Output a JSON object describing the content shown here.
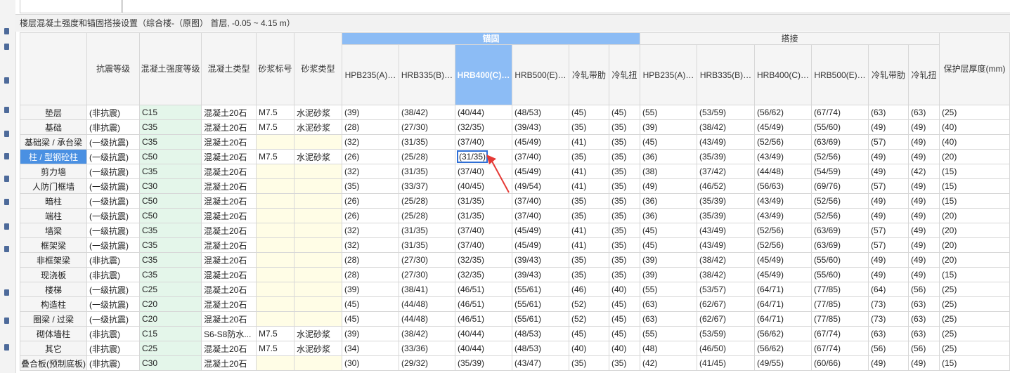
{
  "title": "楼层混凝土强度和锚固搭接设置（综合楼-（原图） 首层, -0.05 ~ 4.15 m）",
  "header": {
    "group_anchor": "锚固",
    "group_lap": "搭接",
    "columns": [
      "抗震等级",
      "混凝土强度等级",
      "混凝土类型",
      "砂浆标号",
      "砂浆类型",
      "HPB235(A)…",
      "HRB335(B)…",
      "HRB400(C)…",
      "HRB500(E)…",
      "冷轧带肋",
      "冷轧扭",
      "HPB235(A)…",
      "HRB335(B)…",
      "HRB400(C)…",
      "HRB500(E)…",
      "冷轧带肋",
      "冷轧扭",
      "保护层厚度(mm)"
    ]
  },
  "rows": [
    {
      "name": "垫层",
      "cells": [
        "(非抗震)",
        "C15",
        "混凝土20石",
        "M7.5",
        "水泥砂浆",
        "(39)",
        "(38/42)",
        "(40/44)",
        "(48/53)",
        "(45)",
        "(45)",
        "(55)",
        "(53/59)",
        "(56/62)",
        "(67/74)",
        "(63)",
        "(63)",
        "(25)"
      ]
    },
    {
      "name": "基础",
      "cells": [
        "(非抗震)",
        "C35",
        "混凝土20石",
        "M7.5",
        "水泥砂浆",
        "(28)",
        "(27/30)",
        "(32/35)",
        "(39/43)",
        "(35)",
        "(35)",
        "(39)",
        "(38/42)",
        "(45/49)",
        "(55/60)",
        "(49)",
        "(49)",
        "(40)"
      ]
    },
    {
      "name": "基础梁 / 承台梁",
      "cells": [
        "(一级抗震)",
        "C35",
        "混凝土20石",
        "",
        "",
        "(32)",
        "(31/35)",
        "(37/40)",
        "(45/49)",
        "(41)",
        "(35)",
        "(45)",
        "(43/49)",
        "(52/56)",
        "(63/69)",
        "(57)",
        "(49)",
        "(40)"
      ]
    },
    {
      "name": "柱 / 型钢砼柱",
      "cells": [
        "(一级抗震)",
        "C50",
        "混凝土20石",
        "M7.5",
        "水泥砂浆",
        "(26)",
        "(25/28)",
        "(31/35)",
        "(37/40)",
        "(35)",
        "(35)",
        "(36)",
        "(35/39)",
        "(43/49)",
        "(52/56)",
        "(49)",
        "(49)",
        "(20)"
      ]
    },
    {
      "name": "剪力墙",
      "cells": [
        "(一级抗震)",
        "C35",
        "混凝土20石",
        "",
        "",
        "(32)",
        "(31/35)",
        "(37/40)",
        "(45/49)",
        "(41)",
        "(35)",
        "(38)",
        "(37/42)",
        "(44/48)",
        "(54/59)",
        "(49)",
        "(42)",
        "(15)"
      ]
    },
    {
      "name": "人防门框墙",
      "cells": [
        "(一级抗震)",
        "C30",
        "混凝土20石",
        "",
        "",
        "(35)",
        "(33/37)",
        "(40/45)",
        "(49/54)",
        "(41)",
        "(35)",
        "(49)",
        "(46/52)",
        "(56/63)",
        "(69/76)",
        "(57)",
        "(49)",
        "(15)"
      ]
    },
    {
      "name": "暗柱",
      "cells": [
        "(一级抗震)",
        "C50",
        "混凝土20石",
        "",
        "",
        "(26)",
        "(25/28)",
        "(31/35)",
        "(37/40)",
        "(35)",
        "(35)",
        "(36)",
        "(35/39)",
        "(43/49)",
        "(52/56)",
        "(49)",
        "(49)",
        "(15)"
      ]
    },
    {
      "name": "端柱",
      "cells": [
        "(一级抗震)",
        "C50",
        "混凝土20石",
        "",
        "",
        "(26)",
        "(25/28)",
        "(31/35)",
        "(37/40)",
        "(35)",
        "(35)",
        "(36)",
        "(35/39)",
        "(43/49)",
        "(52/56)",
        "(49)",
        "(49)",
        "(20)"
      ]
    },
    {
      "name": "墙梁",
      "cells": [
        "(一级抗震)",
        "C35",
        "混凝土20石",
        "",
        "",
        "(32)",
        "(31/35)",
        "(37/40)",
        "(45/49)",
        "(41)",
        "(35)",
        "(45)",
        "(43/49)",
        "(52/56)",
        "(63/69)",
        "(57)",
        "(49)",
        "(20)"
      ]
    },
    {
      "name": "框架梁",
      "cells": [
        "(一级抗震)",
        "C35",
        "混凝土20石",
        "",
        "",
        "(32)",
        "(31/35)",
        "(37/40)",
        "(45/49)",
        "(41)",
        "(35)",
        "(45)",
        "(43/49)",
        "(52/56)",
        "(63/69)",
        "(57)",
        "(49)",
        "(20)"
      ]
    },
    {
      "name": "非框架梁",
      "cells": [
        "(非抗震)",
        "C35",
        "混凝土20石",
        "",
        "",
        "(28)",
        "(27/30)",
        "(32/35)",
        "(39/43)",
        "(35)",
        "(35)",
        "(39)",
        "(38/42)",
        "(45/49)",
        "(55/60)",
        "(49)",
        "(49)",
        "(20)"
      ]
    },
    {
      "name": "现浇板",
      "cells": [
        "(非抗震)",
        "C35",
        "混凝土20石",
        "",
        "",
        "(28)",
        "(27/30)",
        "(32/35)",
        "(39/43)",
        "(35)",
        "(35)",
        "(39)",
        "(38/42)",
        "(45/49)",
        "(55/60)",
        "(49)",
        "(49)",
        "(15)"
      ]
    },
    {
      "name": "楼梯",
      "cells": [
        "(一级抗震)",
        "C25",
        "混凝土20石",
        "",
        "",
        "(39)",
        "(38/41)",
        "(46/51)",
        "(55/61)",
        "(46)",
        "(40)",
        "(55)",
        "(53/57)",
        "(64/71)",
        "(77/85)",
        "(64)",
        "(56)",
        "(25)"
      ]
    },
    {
      "name": "构造柱",
      "cells": [
        "(一级抗震)",
        "C20",
        "混凝土20石",
        "",
        "",
        "(45)",
        "(44/48)",
        "(46/51)",
        "(55/61)",
        "(52)",
        "(45)",
        "(63)",
        "(62/67)",
        "(64/71)",
        "(77/85)",
        "(73)",
        "(63)",
        "(25)"
      ]
    },
    {
      "name": "圈梁 / 过梁",
      "cells": [
        "(一级抗震)",
        "C20",
        "混凝土20石",
        "",
        "",
        "(45)",
        "(44/48)",
        "(46/51)",
        "(55/61)",
        "(52)",
        "(45)",
        "(63)",
        "(62/67)",
        "(64/71)",
        "(77/85)",
        "(73)",
        "(63)",
        "(25)"
      ]
    },
    {
      "name": "砌体墙柱",
      "cells": [
        "(非抗震)",
        "C15",
        "S6-S8防水...",
        "M7.5",
        "水泥砂浆",
        "(39)",
        "(38/42)",
        "(40/44)",
        "(48/53)",
        "(45)",
        "(45)",
        "(55)",
        "(53/59)",
        "(56/62)",
        "(67/74)",
        "(63)",
        "(63)",
        "(25)"
      ]
    },
    {
      "name": "其它",
      "cells": [
        "(非抗震)",
        "C25",
        "混凝土20石",
        "M7.5",
        "水泥砂浆",
        "(34)",
        "(33/36)",
        "(40/44)",
        "(48/53)",
        "(40)",
        "(40)",
        "(48)",
        "(46/50)",
        "(56/62)",
        "(67/74)",
        "(56)",
        "(56)",
        "(25)"
      ]
    },
    {
      "name": "叠合板(预制底板)",
      "cells": [
        "(非抗震)",
        "C30",
        "混凝土20石",
        "",
        "",
        "(30)",
        "(29/32)",
        "(35/39)",
        "(43/47)",
        "(35)",
        "(35)",
        "(42)",
        "(41/45)",
        "(49/55)",
        "(60/66)",
        "(49)",
        "(49)",
        "(15)"
      ]
    }
  ],
  "selected_row": 3,
  "selected_col": 7,
  "colors": {
    "selected_header": "#8cbcf5",
    "selected_row_header": "#4a90e2",
    "green_cell": "#e4f6ea",
    "yellow_cell": "#fffde6",
    "arrow": "#e53935"
  }
}
